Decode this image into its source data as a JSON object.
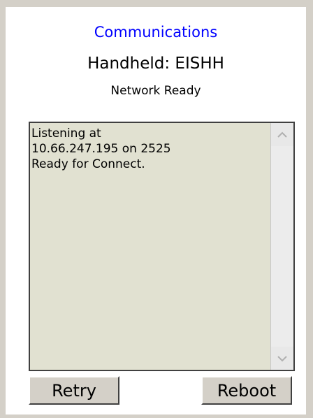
{
  "header": {
    "title": "Communications",
    "handheld": "Handheld: EISHH",
    "status": "Network Ready"
  },
  "log": {
    "text": "Listening at\n10.66.247.195 on 2525\nReady for Connect."
  },
  "buttons": {
    "retry": "Retry",
    "reboot": "Reboot"
  },
  "colors": {
    "title": "#0000ff",
    "log_background": "#e1e1d1",
    "window_background": "#ffffff",
    "frame": "#d4d0c8"
  },
  "icons": {
    "scroll_up": "chevron-up-icon",
    "scroll_down": "chevron-down-icon"
  }
}
